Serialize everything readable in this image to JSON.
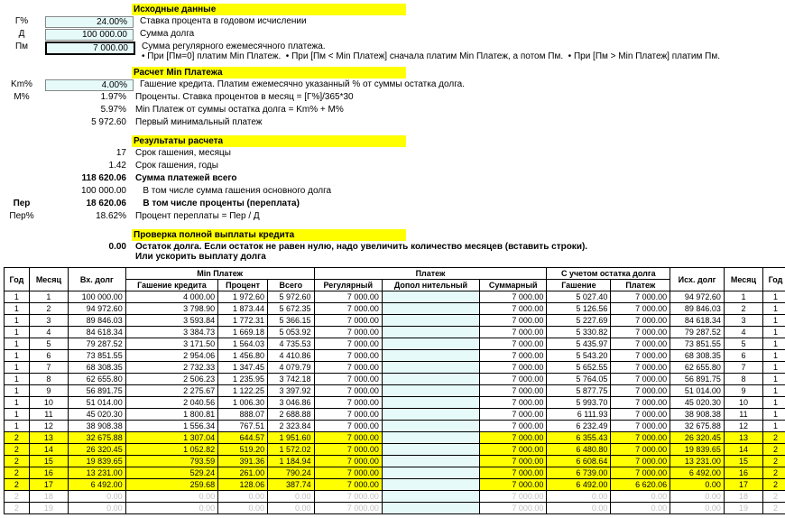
{
  "sections": {
    "initial_title": "Исходные данные",
    "initial": [
      {
        "lbl": "Г%",
        "val": "24.00%",
        "desc": "Ставка процента в годовом исчислении",
        "cyan": true
      },
      {
        "lbl": "Д",
        "val": "100 000.00",
        "desc": "Сумма долга",
        "cyan": true
      },
      {
        "lbl": "Пм",
        "val": "7 000.00",
        "desc": "Сумма регулярного ежемесячного платежа.\n• При [Пм=0] платим Min Платеж.  • При [Пм < Min Платеж] сначала платим Min Платеж, а потом Пм.  • При [Пм > Min Платеж] платим Пм.",
        "cyan": true,
        "thick": true
      }
    ],
    "calc_title": "Расчет Min Платежа",
    "calc": [
      {
        "lbl": "Km%",
        "val": "4.00%",
        "desc": "Гашение кредита. Платим ежемесячно указанный % от суммы остатка долга.",
        "cyan": true
      },
      {
        "lbl": "M%",
        "val": "1.97%",
        "desc": "Проценты. Ставка процентов в месяц = [Г%]/365*30"
      },
      {
        "lbl": "",
        "val": "5.97%",
        "desc": "Min Платеж от суммы остатка долга = Km% + M%"
      },
      {
        "lbl": "",
        "val": "5 972.60",
        "desc": "Первый минимальный платеж"
      }
    ],
    "results_title": "Результаты расчета",
    "results": [
      {
        "lbl": "",
        "val": "17",
        "desc": "Срок гашения, месяцы"
      },
      {
        "lbl": "",
        "val": "1.42",
        "desc": "Срок гашения, годы"
      },
      {
        "lbl": "",
        "val": "118 620.06",
        "desc": "Сумма платежей всего",
        "bold": true
      },
      {
        "lbl": "",
        "val": "100 000.00",
        "desc": "   В том числе сумма гашения основного долга"
      },
      {
        "lbl": "Пер",
        "val": "18 620.06",
        "desc": "   В том числе проценты (переплата)",
        "bold": true
      },
      {
        "lbl": "Пер%",
        "val": "18.62%",
        "desc": "Процент переплаты = Пер / Д"
      }
    ],
    "check_title": "Проверка полной выплаты кредита",
    "check": [
      {
        "lbl": "",
        "val": "0.00",
        "desc": "Остаток долга. Если остаток не равен нулю, надо увеличить количество месяцев (вставить строки).\nИли ускорить выплату долга",
        "bold": true
      }
    ]
  },
  "table": {
    "h_top": {
      "year": "Год",
      "month": "Месяц",
      "debt_in": "Вх. долг",
      "minpay": "Min Платеж",
      "pay": "Платеж",
      "adj": "С учетом остатка долга",
      "debt_out": "Исх. долг",
      "month2": "Месяц",
      "year2": "Год"
    },
    "h_sub": {
      "principal": "Гашение кредита",
      "interest": "Процент",
      "total": "Всего",
      "regular": "Регулярный",
      "extra": "Допол нительный",
      "sum": "Суммарный",
      "adj_principal": "Гашение",
      "adj_pay": "Платеж"
    },
    "rows": [
      {
        "y": "1",
        "m": "1",
        "din": "100 000.00",
        "p": "4 000.00",
        "i": "1 972.60",
        "t": "5 972.60",
        "reg": "7 000.00",
        "dop": "",
        "sum": "7 000.00",
        "ap": "5 027.40",
        "apay": "7 000.00",
        "dout": "94 972.60",
        "m2": "1",
        "y2": "1"
      },
      {
        "y": "1",
        "m": "2",
        "din": "94 972.60",
        "p": "3 798.90",
        "i": "1 873.44",
        "t": "5 672.35",
        "reg": "7 000.00",
        "dop": "",
        "sum": "7 000.00",
        "ap": "5 126.56",
        "apay": "7 000.00",
        "dout": "89 846.03",
        "m2": "2",
        "y2": "1"
      },
      {
        "y": "1",
        "m": "3",
        "din": "89 846.03",
        "p": "3 593.84",
        "i": "1 772.31",
        "t": "5 366.15",
        "reg": "7 000.00",
        "dop": "",
        "sum": "7 000.00",
        "ap": "5 227.69",
        "apay": "7 000.00",
        "dout": "84 618.34",
        "m2": "3",
        "y2": "1"
      },
      {
        "y": "1",
        "m": "4",
        "din": "84 618.34",
        "p": "3 384.73",
        "i": "1 669.18",
        "t": "5 053.92",
        "reg": "7 000.00",
        "dop": "",
        "sum": "7 000.00",
        "ap": "5 330.82",
        "apay": "7 000.00",
        "dout": "79 287.52",
        "m2": "4",
        "y2": "1"
      },
      {
        "y": "1",
        "m": "5",
        "din": "79 287.52",
        "p": "3 171.50",
        "i": "1 564.03",
        "t": "4 735.53",
        "reg": "7 000.00",
        "dop": "",
        "sum": "7 000.00",
        "ap": "5 435.97",
        "apay": "7 000.00",
        "dout": "73 851.55",
        "m2": "5",
        "y2": "1"
      },
      {
        "y": "1",
        "m": "6",
        "din": "73 851.55",
        "p": "2 954.06",
        "i": "1 456.80",
        "t": "4 410.86",
        "reg": "7 000.00",
        "dop": "",
        "sum": "7 000.00",
        "ap": "5 543.20",
        "apay": "7 000.00",
        "dout": "68 308.35",
        "m2": "6",
        "y2": "1"
      },
      {
        "y": "1",
        "m": "7",
        "din": "68 308.35",
        "p": "2 732.33",
        "i": "1 347.45",
        "t": "4 079.79",
        "reg": "7 000.00",
        "dop": "",
        "sum": "7 000.00",
        "ap": "5 652.55",
        "apay": "7 000.00",
        "dout": "62 655.80",
        "m2": "7",
        "y2": "1"
      },
      {
        "y": "1",
        "m": "8",
        "din": "62 655.80",
        "p": "2 506.23",
        "i": "1 235.95",
        "t": "3 742.18",
        "reg": "7 000.00",
        "dop": "",
        "sum": "7 000.00",
        "ap": "5 764.05",
        "apay": "7 000.00",
        "dout": "56 891.75",
        "m2": "8",
        "y2": "1"
      },
      {
        "y": "1",
        "m": "9",
        "din": "56 891.75",
        "p": "2 275.67",
        "i": "1 122.25",
        "t": "3 397.92",
        "reg": "7 000.00",
        "dop": "",
        "sum": "7 000.00",
        "ap": "5 877.75",
        "apay": "7 000.00",
        "dout": "51 014.00",
        "m2": "9",
        "y2": "1"
      },
      {
        "y": "1",
        "m": "10",
        "din": "51 014.00",
        "p": "2 040.56",
        "i": "1 006.30",
        "t": "3 046.86",
        "reg": "7 000.00",
        "dop": "",
        "sum": "7 000.00",
        "ap": "5 993.70",
        "apay": "7 000.00",
        "dout": "45 020.30",
        "m2": "10",
        "y2": "1"
      },
      {
        "y": "1",
        "m": "11",
        "din": "45 020.30",
        "p": "1 800.81",
        "i": "888.07",
        "t": "2 688.88",
        "reg": "7 000.00",
        "dop": "",
        "sum": "7 000.00",
        "ap": "6 111.93",
        "apay": "7 000.00",
        "dout": "38 908.38",
        "m2": "11",
        "y2": "1"
      },
      {
        "y": "1",
        "m": "12",
        "din": "38 908.38",
        "p": "1 556.34",
        "i": "767.51",
        "t": "2 323.84",
        "reg": "7 000.00",
        "dop": "",
        "sum": "7 000.00",
        "ap": "6 232.49",
        "apay": "7 000.00",
        "dout": "32 675.88",
        "m2": "12",
        "y2": "1"
      },
      {
        "y": "2",
        "m": "13",
        "din": "32 675.88",
        "p": "1 307.04",
        "i": "644.57",
        "t": "1 951.60",
        "reg": "7 000.00",
        "dop": "",
        "sum": "7 000.00",
        "ap": "6 355.43",
        "apay": "7 000.00",
        "dout": "26 320.45",
        "m2": "13",
        "y2": "2",
        "hl": true
      },
      {
        "y": "2",
        "m": "14",
        "din": "26 320.45",
        "p": "1 052.82",
        "i": "519.20",
        "t": "1 572.02",
        "reg": "7 000.00",
        "dop": "",
        "sum": "7 000.00",
        "ap": "6 480.80",
        "apay": "7 000.00",
        "dout": "19 839.65",
        "m2": "14",
        "y2": "2",
        "hl": true
      },
      {
        "y": "2",
        "m": "15",
        "din": "19 839.65",
        "p": "793.59",
        "i": "391.36",
        "t": "1 184.94",
        "reg": "7 000.00",
        "dop": "",
        "sum": "7 000.00",
        "ap": "6 608.64",
        "apay": "7 000.00",
        "dout": "13 231.00",
        "m2": "15",
        "y2": "2",
        "hl": true
      },
      {
        "y": "2",
        "m": "16",
        "din": "13 231.00",
        "p": "529.24",
        "i": "261.00",
        "t": "790.24",
        "reg": "7 000.00",
        "dop": "",
        "sum": "7 000.00",
        "ap": "6 739.00",
        "apay": "7 000.00",
        "dout": "6 492.00",
        "m2": "16",
        "y2": "2",
        "hl": true
      },
      {
        "y": "2",
        "m": "17",
        "din": "6 492.00",
        "p": "259.68",
        "i": "128.06",
        "t": "387.74",
        "reg": "7 000.00",
        "dop": "",
        "sum": "7 000.00",
        "ap": "6 492.00",
        "apay": "6 620.06",
        "dout": "0.00",
        "m2": "17",
        "y2": "2",
        "hl": true
      },
      {
        "y": "2",
        "m": "18",
        "din": "0.00",
        "p": "0.00",
        "i": "0.00",
        "t": "0.00",
        "reg": "7 000.00",
        "dop": "",
        "sum": "7 000.00",
        "ap": "0.00",
        "apay": "0.00",
        "dout": "0.00",
        "m2": "18",
        "y2": "2",
        "faded": true
      },
      {
        "y": "2",
        "m": "19",
        "din": "0.00",
        "p": "0.00",
        "i": "0.00",
        "t": "0.00",
        "reg": "7 000.00",
        "dop": "",
        "sum": "7 000.00",
        "ap": "0.00",
        "apay": "0.00",
        "dout": "0.00",
        "m2": "19",
        "y2": "2",
        "faded": true
      }
    ]
  }
}
